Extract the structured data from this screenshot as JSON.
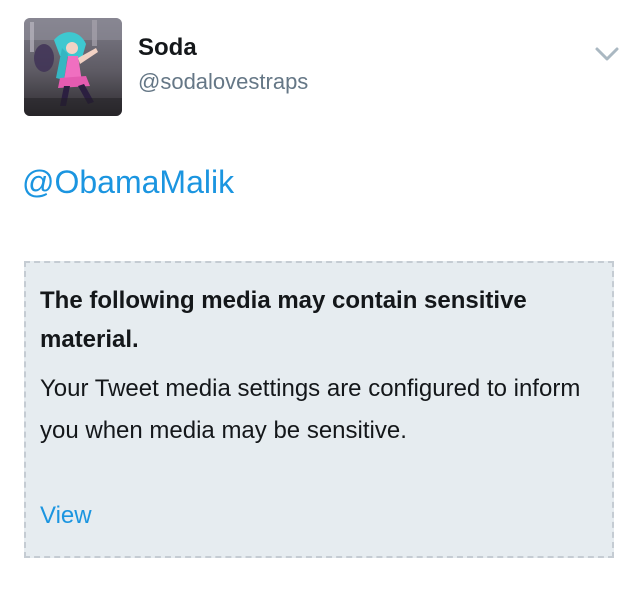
{
  "tweet": {
    "user": {
      "name": "Soda",
      "handle": "@sodalovestraps"
    },
    "text": "@ObamaMalik",
    "sensitive_media": {
      "title": "The following media may contain sensitive material.",
      "message": "Your Tweet media settings are configured to inform you when media may be sensitive.",
      "view_label": "View"
    }
  },
  "icons": {
    "menu": "chevron-down-icon",
    "avatar": "profile-photo"
  },
  "colors": {
    "link": "#1b95e0",
    "secondary_text": "#657786",
    "primary_text": "#14171a",
    "warning_bg": "#e6ecf0",
    "warning_border": "#c5ccd3"
  }
}
